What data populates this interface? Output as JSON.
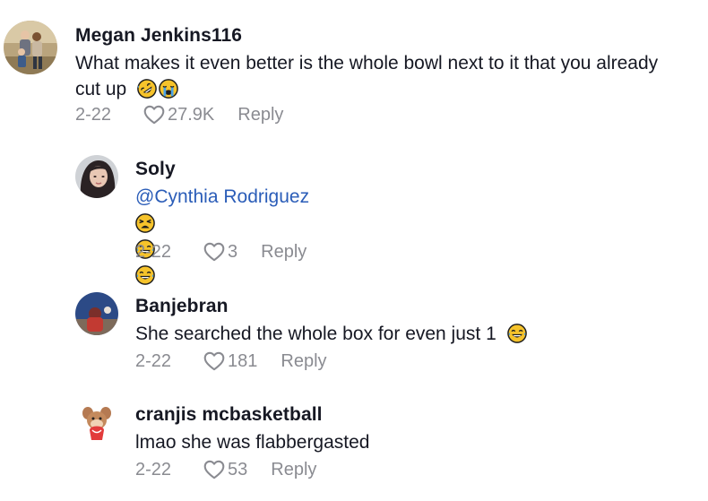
{
  "comments": [
    {
      "author": "Megan Jenkins116",
      "text_line1": "What makes it even better is the whole bowl next to it that you already",
      "text_line2": "cut up",
      "emojis": [
        "rolling-on-floor-laughing",
        "loudly-crying"
      ],
      "date": "2-22",
      "likes": "27.9K",
      "reply_label": "Reply"
    },
    {
      "author": "Soly",
      "mention": "@Cynthia Rodriguez",
      "emojis": [
        "weary-face",
        "tears-of-joy",
        "tears-of-joy"
      ],
      "date": "2-22",
      "likes": "3",
      "reply_label": "Reply"
    },
    {
      "author": "Banjebran",
      "text": "She searched the whole box for even just 1",
      "emojis": [
        "tears-of-joy"
      ],
      "date": "2-22",
      "likes": "181",
      "reply_label": "Reply"
    },
    {
      "author": "cranjis mcbasketball",
      "text": "lmao she was flabbergasted",
      "date": "2-22",
      "likes": "53",
      "reply_label": "Reply"
    }
  ],
  "icons": {
    "like": "heart-outline-icon",
    "more": "more-dots-icon"
  },
  "colors": {
    "text": "#161823",
    "muted": "#8a8b91",
    "mention": "#2b5db8",
    "emoji": "#f6c32b"
  }
}
